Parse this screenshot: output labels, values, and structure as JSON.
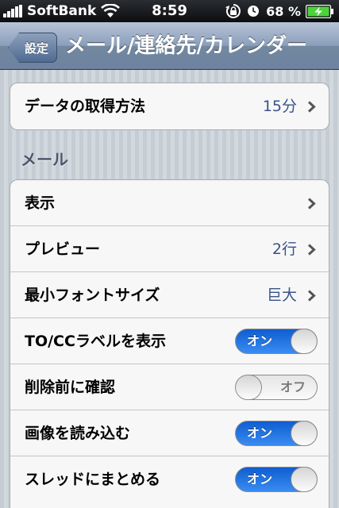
{
  "status_bar": {
    "carrier": "SoftBank",
    "time": "8:59",
    "battery_percent": "68 %"
  },
  "nav": {
    "back_label": "設定",
    "title": "メール/連絡先/カレンダー"
  },
  "fetch_group": {
    "label": "データの取得方法",
    "value": "15分"
  },
  "mail_section": {
    "header": "メール",
    "rows": [
      {
        "label": "表示",
        "value": ""
      },
      {
        "label": "プレビュー",
        "value": "2行"
      },
      {
        "label": "最小フォントサイズ",
        "value": "巨大"
      }
    ],
    "toggles": [
      {
        "label": "TO/CCラベルを表示",
        "state": "オン"
      },
      {
        "label": "削除前に確認",
        "state": "オフ"
      },
      {
        "label": "画像を読み込む",
        "state": "オン"
      },
      {
        "label": "スレッドにまとめる",
        "state": "オン"
      }
    ]
  },
  "icons": [
    "signal-bars-icon",
    "wifi-icon",
    "rotation-lock-icon",
    "alarm-clock-icon",
    "battery-charging-icon",
    "chevron-right-icon"
  ]
}
